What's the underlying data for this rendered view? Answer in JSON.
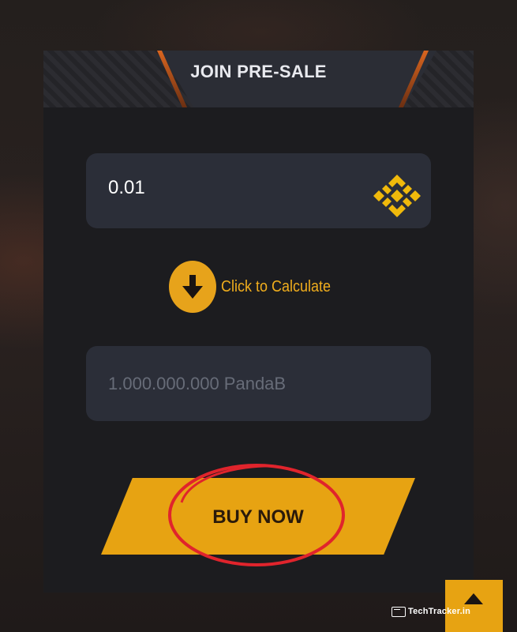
{
  "presale": {
    "title": "JOIN PRE-SALE",
    "amount_value": "0.01",
    "currency_icon": "binance-bnb-icon",
    "calculate_icon": "arrow-down-icon",
    "calculate_label": "Click to Calculate",
    "result_placeholder": "1.000.000.000 PandaB",
    "buy_label": "BUY NOW"
  },
  "scroll_top": {
    "icon": "chevron-up-icon"
  },
  "watermark": {
    "text": "TechTracker.in"
  },
  "colors": {
    "accent": "#e7a312",
    "card_background": "#1c1c1f",
    "field_background": "#2b2e38",
    "highlight_circle": "#e0242c"
  }
}
